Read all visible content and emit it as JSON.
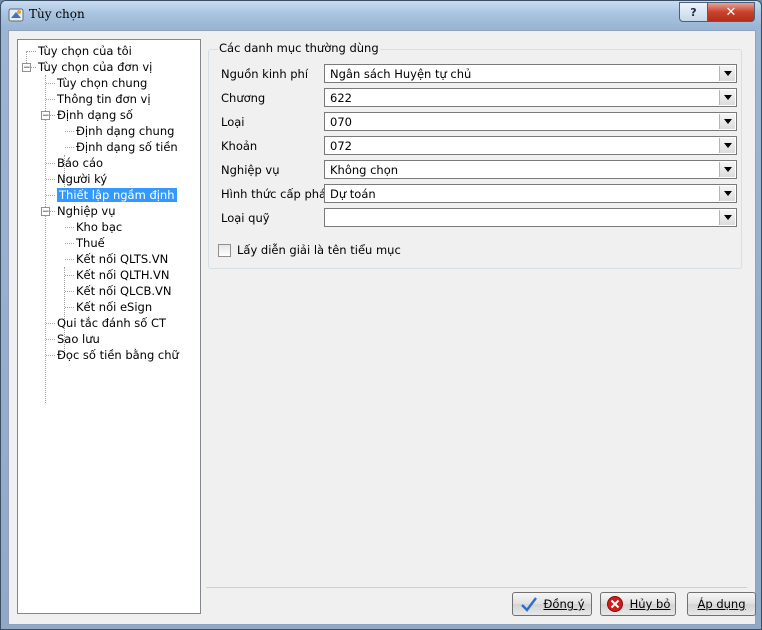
{
  "window": {
    "title": "Tùy chọn",
    "help_label": "?",
    "close_label": "✕"
  },
  "tree": {
    "items": [
      {
        "label": "Tùy chọn của tôi",
        "level": 0
      },
      {
        "label": "Tùy chọn của đơn vị",
        "level": 0,
        "expander": "−"
      },
      {
        "label": "Tùy chọn chung",
        "level": 1
      },
      {
        "label": "Thông tin đơn vị",
        "level": 1
      },
      {
        "label": "Định dạng số",
        "level": 1,
        "expander": "−"
      },
      {
        "label": "Định dạng chung",
        "level": 2
      },
      {
        "label": "Định dạng số tiền",
        "level": 2
      },
      {
        "label": "Báo cáo",
        "level": 1
      },
      {
        "label": "Người ký",
        "level": 1
      },
      {
        "label": "Thiết lập ngầm định",
        "level": 1,
        "selected": true
      },
      {
        "label": "Nghiệp vụ",
        "level": 1,
        "expander": "−"
      },
      {
        "label": "Kho bạc",
        "level": 2
      },
      {
        "label": "Thuế",
        "level": 2
      },
      {
        "label": "Kết nối QLTS.VN",
        "level": 2
      },
      {
        "label": "Kết nối QLTH.VN",
        "level": 2
      },
      {
        "label": "Kết nối QLCB.VN",
        "level": 2
      },
      {
        "label": "Kết nối eSign",
        "level": 2
      },
      {
        "label": "Qui tắc đánh số CT",
        "level": 1
      },
      {
        "label": "Sao lưu",
        "level": 1
      },
      {
        "label": "Đọc số tiền bằng chữ",
        "level": 1
      }
    ]
  },
  "group": {
    "title": "Các danh mục thường dùng",
    "fields": [
      {
        "label": "Nguồn kinh phí",
        "value": "Ngân sách Huyện tự chủ"
      },
      {
        "label": "Chương",
        "value": "622"
      },
      {
        "label": "Loại",
        "value": "070"
      },
      {
        "label": "Khoản",
        "value": "072"
      },
      {
        "label": "Nghiệp vụ",
        "value": "Không chọn"
      },
      {
        "label": "Hình thức cấp phát",
        "value": "Dự toán"
      },
      {
        "label": "Loại quỹ",
        "value": ""
      }
    ],
    "checkbox_label": "Lấy diễn giải là tên tiểu mục",
    "checkbox_checked": false
  },
  "buttons": {
    "ok": "Đồng ý",
    "cancel": "Hủy bỏ",
    "apply": "Áp dụng"
  },
  "colors": {
    "selection": "#3399ff",
    "ok_icon": "#2b6fc9",
    "cancel_icon": "#d11a1a"
  }
}
